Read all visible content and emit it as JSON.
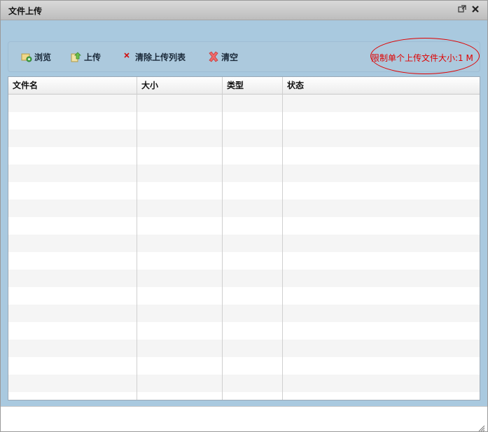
{
  "window": {
    "title": "文件上传"
  },
  "titlebar_buttons": {
    "restore_icon": "⧉",
    "close_icon": "✖"
  },
  "toolbar": {
    "browse_label": "浏览",
    "upload_label": "上传",
    "clear_list_label": "清除上传列表",
    "clear_label": "清空",
    "limit_text": "限制单个上传文件大小:1 M"
  },
  "table": {
    "columns": [
      "文件名",
      "大小",
      "类型",
      "状态"
    ],
    "rows": []
  },
  "colors": {
    "accent": "#a9c9df",
    "limit": "#e00000"
  }
}
